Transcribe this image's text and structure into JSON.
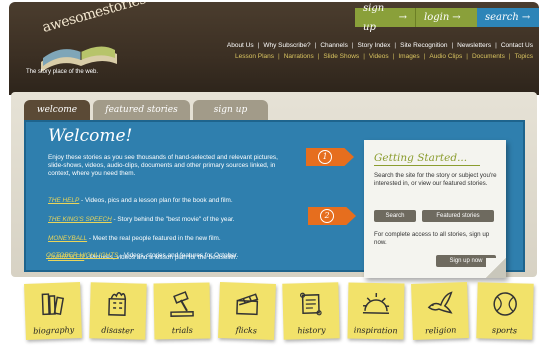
{
  "brand": {
    "logo_text": "awesomestories",
    "tagline": "The story place of the web."
  },
  "header_buttons": {
    "signup": "sign up",
    "login": "login",
    "search": "search"
  },
  "main_nav": [
    "About Us",
    "Why Subscribe?",
    "Channels",
    "Story Index",
    "Site Recognition",
    "Newsletters",
    "Contact Us"
  ],
  "sub_nav": [
    "Lesson Plans",
    "Narrations",
    "Slide Shows",
    "Videos",
    "Images",
    "Audio Clips",
    "Documents",
    "Topics"
  ],
  "tabs": {
    "welcome": "welcome",
    "featured": "featured stories",
    "signup": "sign up"
  },
  "welcome": {
    "title": "Welcome!",
    "intro": "Enjoy these stories as you see thousands of hand-selected and relevant pictures, slide-shows, videos, audio-clips, documents and other primary sources linked, in context, where you need them.",
    "stories": [
      {
        "link": "THE HELP",
        "text": " - Videos, pics and a lesson plan for the book and film."
      },
      {
        "link": "THE KING'S SPEECH",
        "text": " - Story behind the \"best movie\" of the year."
      },
      {
        "link": "MONEYBALL",
        "text": " - Meet the real people featured in the new film."
      },
      {
        "link": "UNBROKEN",
        "text": " - Pictures, videos and a lesson plan for the bestseller."
      },
      {
        "link": "OCTOBER HIGHLIGHTS",
        "text": " - Videos, stories and features for October."
      }
    ]
  },
  "getting_started": {
    "title": "Getting Started...",
    "step1_text": "Search the site for the story or subject you're interested in, or view our featured stories.",
    "search_btn": "Search",
    "featured_btn": "Featured stories",
    "step2_text": "For complete access to all stories, sign up now.",
    "signup_btn": "Sign up now",
    "step1_num": "1",
    "step2_num": "2"
  },
  "categories": [
    "biography",
    "disaster",
    "trials",
    "flicks",
    "history",
    "inspiration",
    "religion",
    "sports"
  ],
  "colors": {
    "header_bg": "#3b2f23",
    "accent_green": "#8aa03a",
    "accent_blue": "#2d85b8",
    "panel_blue": "#2f7fae",
    "link_yellow": "#e9d55a",
    "step_orange": "#e66e1e",
    "sticky_yellow": "#f2e26a"
  }
}
